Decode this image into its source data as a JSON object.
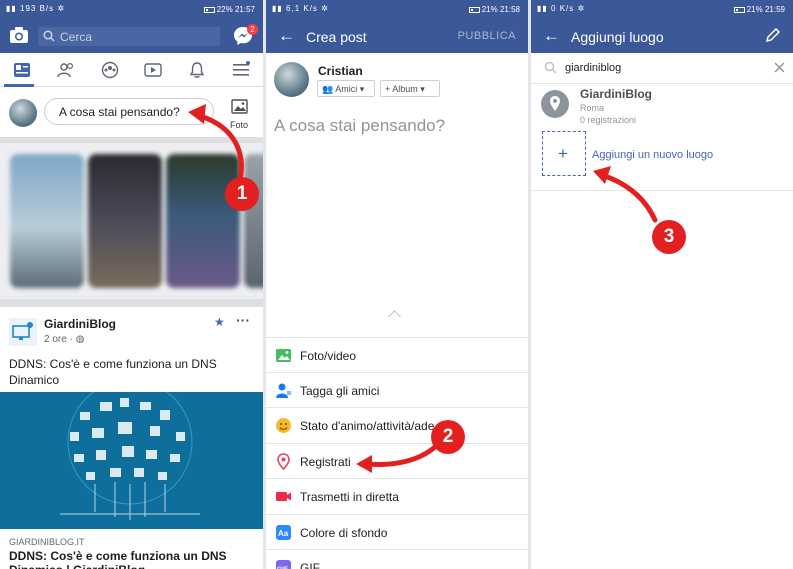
{
  "panel1": {
    "status": {
      "left": "▮▮ 193 B/s ✲",
      "right": "22%  21:57"
    },
    "search_placeholder": "Cerca",
    "messenger_badge": "2",
    "composer_placeholder": "A cosa stai pensando?",
    "photo_label": "Foto",
    "post": {
      "author": "GiardiniBlog",
      "time": "2 ore · ",
      "text": "DDNS: Cos'è e come funziona un DNS Dinamico",
      "link_domain": "GIARDINIBLOG.IT",
      "link_title": "DDNS: Cos'è e come funziona un DNS Dinamico | GiardiniBlog"
    },
    "step_number": "1"
  },
  "panel2": {
    "status": {
      "left": "▮▮ 6,1 K/s ✲",
      "right": "21%  21:58"
    },
    "title": "Crea post",
    "action": "PUBBLICA",
    "user_name": "Cristian",
    "audience_chip": "Amici",
    "album_chip": "+ Album",
    "placeholder": "A cosa stai pensando?",
    "menu": [
      {
        "label": "Foto/video",
        "icon": "photo-icon"
      },
      {
        "label": "Tagga gli amici",
        "icon": "tag-friends-icon"
      },
      {
        "label": "Stato d'animo/attività/ade",
        "icon": "emoji-icon"
      },
      {
        "label": "Registrati",
        "icon": "location-pin-icon"
      },
      {
        "label": "Trasmetti in diretta",
        "icon": "live-video-icon"
      },
      {
        "label": "Colore di sfondo",
        "icon": "background-color-icon"
      },
      {
        "label": "GIF",
        "icon": "gif-icon"
      }
    ],
    "step_number": "2"
  },
  "panel3": {
    "status": {
      "left": "▮▮ 0 K/s ✲",
      "right": "21%  21:59"
    },
    "title": "Aggiungi luogo",
    "search_query": "giardiniblog",
    "place": {
      "name": "GiardiniBlog",
      "city": "Roma",
      "checkins": "0 registrazioni"
    },
    "add_place_label": "Aggiungi un nuovo luogo",
    "step_number": "3"
  },
  "colors": {
    "facebook_blue": "#3b5998",
    "link_blue": "#4267b2",
    "annotation_red": "#e32020"
  }
}
